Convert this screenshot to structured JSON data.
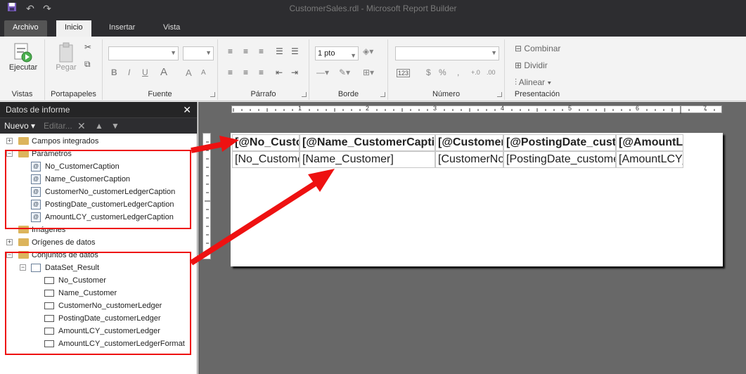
{
  "window": {
    "title": "CustomerSales.rdl - Microsoft Report Builder"
  },
  "tabs": [
    "Archivo",
    "Inicio",
    "Insertar",
    "Vista"
  ],
  "ribbon": {
    "vistas": {
      "button": "Ejecutar",
      "label": "Vistas"
    },
    "portapapeles": {
      "button": "Pegar",
      "label": "Portapapeles"
    },
    "fuente": {
      "label": "Fuente"
    },
    "parrafo": {
      "label": "Párrafo"
    },
    "borde": {
      "width": "1 pto",
      "label": "Borde"
    },
    "numero": {
      "label": "Número",
      "pct": "%",
      "comma": ","
    },
    "presentacion": {
      "combinar": "Combinar",
      "dividir": "Dividir",
      "alinear": "Alinear",
      "label": "Presentación"
    }
  },
  "panel": {
    "title": "Datos de informe",
    "nuevo": "Nuevo",
    "editar": "Editar...",
    "tree": {
      "campos": "Campos integrados",
      "parametros": "Parámetros",
      "params": [
        "No_CustomerCaption",
        "Name_CustomerCaption",
        "CustomerNo_customerLedgerCaption",
        "PostingDate_customerLedgerCaption",
        "AmountLCY_customerLedgerCaption"
      ],
      "imagenes": "Imágenes",
      "origenes": "Orígenes de datos",
      "conjuntos": "Conjuntos de datos",
      "dataset": "DataSet_Result",
      "fields": [
        "No_Customer",
        "Name_Customer",
        "CustomerNo_customerLedger",
        "PostingDate_customerLedger",
        "AmountLCY_customerLedger",
        "AmountLCY_customerLedgerFormat"
      ]
    }
  },
  "ruler": [
    "1",
    "2",
    "3",
    "4",
    "5",
    "6",
    "7"
  ],
  "table": {
    "headers": [
      "[@No_Customer",
      "[@Name_CustomerCaption",
      "[@CustomerNo",
      "[@PostingDate_customer",
      "[@AmountLCY"
    ],
    "row": [
      "[No_Customer",
      "[Name_Customer]",
      "[CustomerNo_",
      "[PostingDate_customer",
      "[AmountLCY_"
    ]
  },
  "colors": {
    "accent_red": "#e11111",
    "dark": "#2d2d30"
  }
}
